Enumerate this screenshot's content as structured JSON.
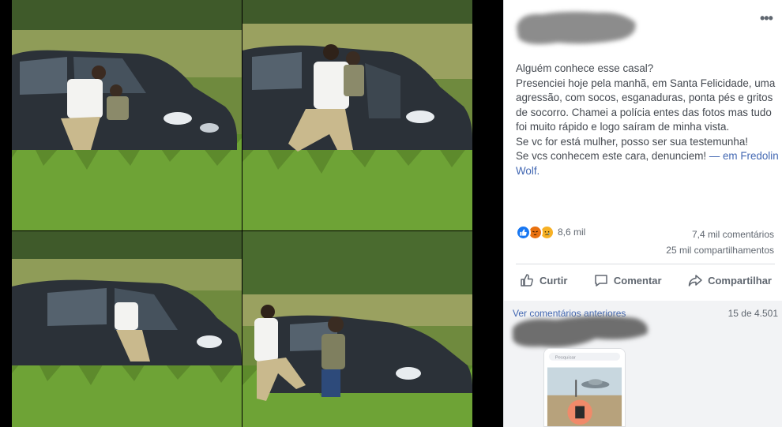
{
  "post": {
    "more_label": "•••",
    "text_lines": [
      "Alguém conhece esse casal?",
      "Presenciei hoje pela manhã, em Santa Felicidade, uma agressão, com socos, esganaduras, ponta pés e gritos de socorro. Chamei a polícia entes das fotos mas tudo foi muito rápido e logo saíram de minha vista.",
      "Se vc for está mulher, posso ser sua testemunha!"
    ],
    "last_line": "Se vcs conhecem este cara, denunciem!",
    "tag_prefix": " — em",
    "tag_place": "Fredolin Wolf."
  },
  "reactions": {
    "icons": [
      "like-icon",
      "angry-icon",
      "sad-icon"
    ],
    "count": "8,6 mil"
  },
  "stats": {
    "comments": "7,4 mil comentários",
    "shares": "25 mil compartilhamentos"
  },
  "actions": {
    "like": "Curtir",
    "comment": "Comentar",
    "share": "Compartilhar"
  },
  "comments": {
    "view_previous": "Ver comentários anteriores",
    "count": "15 de 4.501",
    "search_placeholder": "Pesquisar"
  },
  "colors": {
    "link": "#4267b2",
    "text": "#444950",
    "muted": "#606770",
    "like": "#1877f2",
    "angry": "#e9710f",
    "sad": "#f7b125"
  }
}
